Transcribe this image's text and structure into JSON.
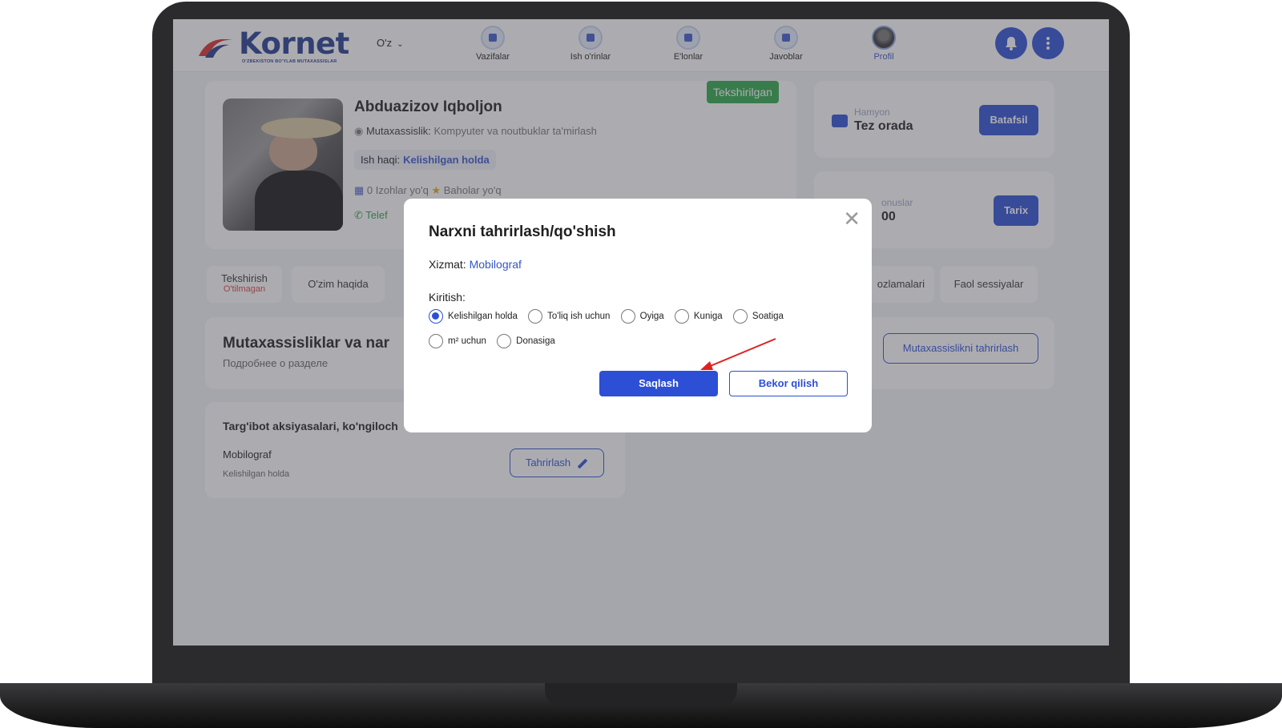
{
  "header": {
    "logo_text": "Kornet",
    "logo_sub": "O'ZBEKISTON BO'YLAB MUTAXASSISLAR",
    "lang": "O'z",
    "nav": [
      {
        "label": "Vazifalar",
        "icon": "tasks-icon"
      },
      {
        "label": "Ish o'rinlar",
        "icon": "jobs-icon"
      },
      {
        "label": "E'lonlar",
        "icon": "ads-icon"
      },
      {
        "label": "Javoblar",
        "icon": "replies-icon"
      },
      {
        "label": "Profil",
        "icon": "avatar"
      }
    ],
    "bell_icon": "bell-icon",
    "menu_icon": "more-vertical-icon"
  },
  "profile": {
    "name": "Abduazizov Iqboljon",
    "spec_label": "Mutaxassislik:",
    "spec_value": "Kompyuter va noutbuklar ta'mirlash",
    "salary_label": "Ish haqi:",
    "salary_value": "Kelishilgan holda",
    "reviews": "0 Izohlar yo'q",
    "ratings": "Baholar yo'q",
    "phone_label": "Telef",
    "status_badge": "Tekshirilgan"
  },
  "wallet": {
    "label": "Hamyon",
    "value": "Tez orada",
    "button": "Batafsil"
  },
  "bonus": {
    "label": "onuslar",
    "value": "00",
    "button": "Tarix"
  },
  "tabs": [
    {
      "label": "Tekshirish",
      "sub": "O'tilmagan"
    },
    {
      "label": "O'zim haqida"
    },
    {
      "label": "ozlamalari"
    },
    {
      "label": "Faol sessiyalar"
    }
  ],
  "specialties": {
    "title": "Mutaxassisliklar va nar",
    "subtitle": "Подробнее о разделе",
    "edit_button": "Mutaxassislikni tahrirlash"
  },
  "promo": {
    "title": "Targ'ibot aksiyasalari, ko'ngiloch",
    "item_name": "Mobilograf",
    "item_price": "Kelishilgan holda",
    "edit_button": "Tahrirlash"
  },
  "modal": {
    "title": "Narxni tahrirlash/qo'shish",
    "service_label": "Xizmat:",
    "service_value": "Mobilograf",
    "input_label": "Kiritish:",
    "options": [
      {
        "label": "Kelishilgan holda",
        "checked": true
      },
      {
        "label": "To'liq ish uchun",
        "checked": false
      },
      {
        "label": "Oyiga",
        "checked": false
      },
      {
        "label": "Kuniga",
        "checked": false
      },
      {
        "label": "Soatiga",
        "checked": false
      },
      {
        "label": "m² uchun",
        "checked": false
      },
      {
        "label": "Donasiga",
        "checked": false
      }
    ],
    "save_button": "Saqlash",
    "cancel_button": "Bekor qilish",
    "close_icon": "close-icon"
  },
  "colors": {
    "brand": "#2c4fd6",
    "success": "#2ea84a",
    "annotation_arrow": "#e02020"
  }
}
